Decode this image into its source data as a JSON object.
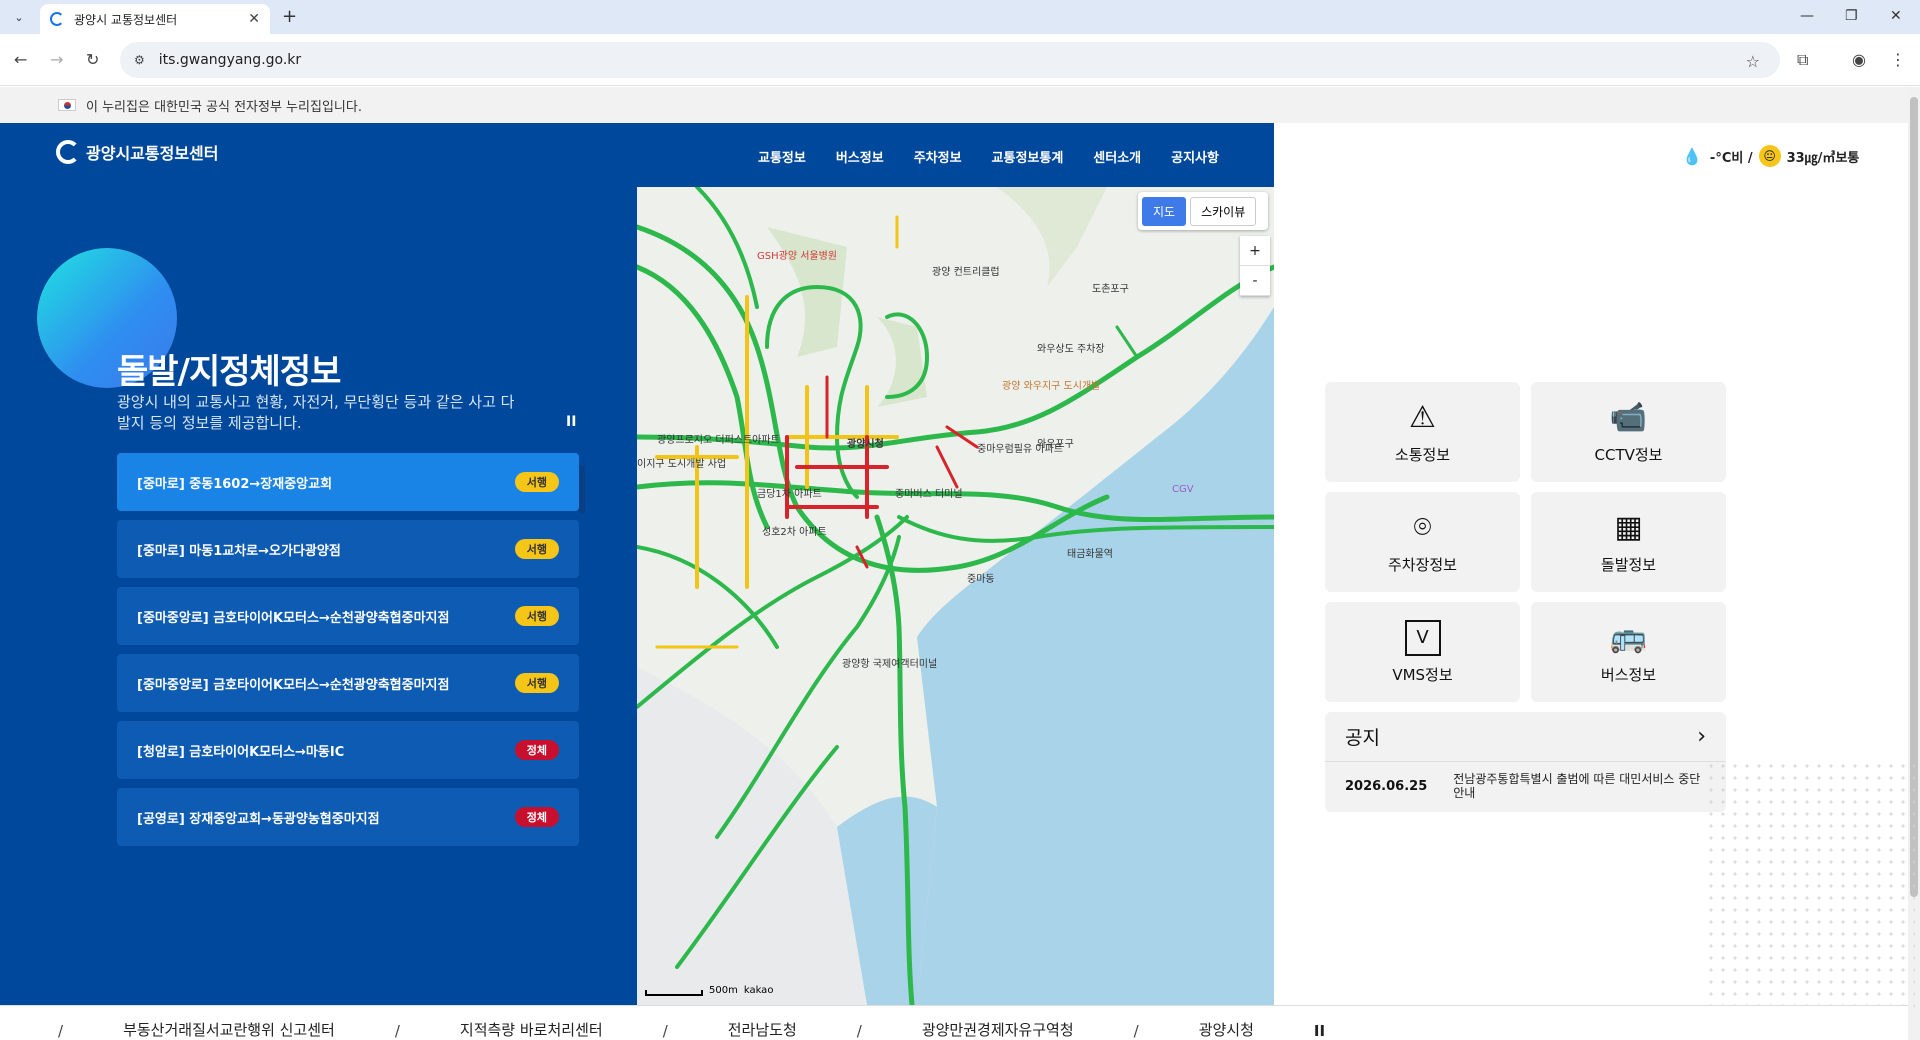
{
  "browser": {
    "tab_title": "광양시 교통정보센터",
    "url": "its.gwangyang.go.kr"
  },
  "gov_banner": "이 누리집은 대한민국 공식 전자정부 누리집입니다.",
  "site": {
    "logo": "광양시교통정보센터",
    "nav": [
      "교통정보",
      "버스정보",
      "주차정보",
      "교통정보통계",
      "센터소개",
      "공지사항"
    ],
    "weather": {
      "temp": "-°C비 /",
      "dust": "33㎍/㎥",
      "grade": "보통"
    }
  },
  "hero": {
    "title": "돌발/지정체정보",
    "desc": "광양시 내의 교통사고 현황, 자전거, 무단횡단 등과 같은 사고 다발지 등의 정보를 제공합니다.",
    "pause": "II"
  },
  "incidents": [
    {
      "text": "[중마로] 중동1602→장재중앙교회",
      "status": "서행",
      "type": "slow"
    },
    {
      "text": "[중마로] 마동1교차로→오가다광양점",
      "status": "서행",
      "type": "slow"
    },
    {
      "text": "[중마중앙로] 금호타이어K모터스→순천광양축협중마지점",
      "status": "서행",
      "type": "slow"
    },
    {
      "text": "[중마중앙로] 금호타이어K모터스→순천광양축협중마지점",
      "status": "서행",
      "type": "slow"
    },
    {
      "text": "[청암로] 금호타이어K모터스→마동IC",
      "status": "정체",
      "type": "jam"
    },
    {
      "text": "[공영로] 장재중앙교회→동광양농협중마지점",
      "status": "정체",
      "type": "jam"
    }
  ],
  "map": {
    "toggle": [
      "지도",
      "스카이뷰"
    ],
    "zoom_in": "+",
    "zoom_out": "-",
    "scale": "500m",
    "attribution": "kakao",
    "labels": [
      "GSH광양 서울병원",
      "광양 컨트리클럽",
      "도촌포구",
      "와우상도 주차장",
      "광양 와우지구 도시개발",
      "광양프로지오 더퍼스트아파트",
      "광양시청",
      "중마우럼필유 아파트",
      "와우포구",
      "중마버스 터미널",
      "금당1차 아파트",
      "성호2차 아파트",
      "CGV",
      "태금화물역",
      "광양항 국제여객터미널",
      "이지구 도시개발 사업",
      "중마동"
    ]
  },
  "tiles": [
    {
      "icon": "road-icon",
      "label": "소통정보"
    },
    {
      "icon": "cctv-icon",
      "label": "CCTV정보"
    },
    {
      "icon": "parking-icon",
      "label": "주차장정보"
    },
    {
      "icon": "barrier-icon",
      "label": "돌발정보"
    },
    {
      "icon": "vms-icon",
      "label": "VMS정보"
    },
    {
      "icon": "bus-icon",
      "label": "버스정보"
    }
  ],
  "notice": {
    "title": "공지",
    "date": "2026.06.25",
    "text": "전남광주통합특별시 출범에 따른 대민서비스 중단 안내"
  },
  "footer": [
    "부동산거래질서교란행위 신고센터",
    "지적측량 바로처리센터",
    "전라남도청",
    "광양만권경제자유구역청",
    "광양시청"
  ],
  "footer_pause": "II"
}
